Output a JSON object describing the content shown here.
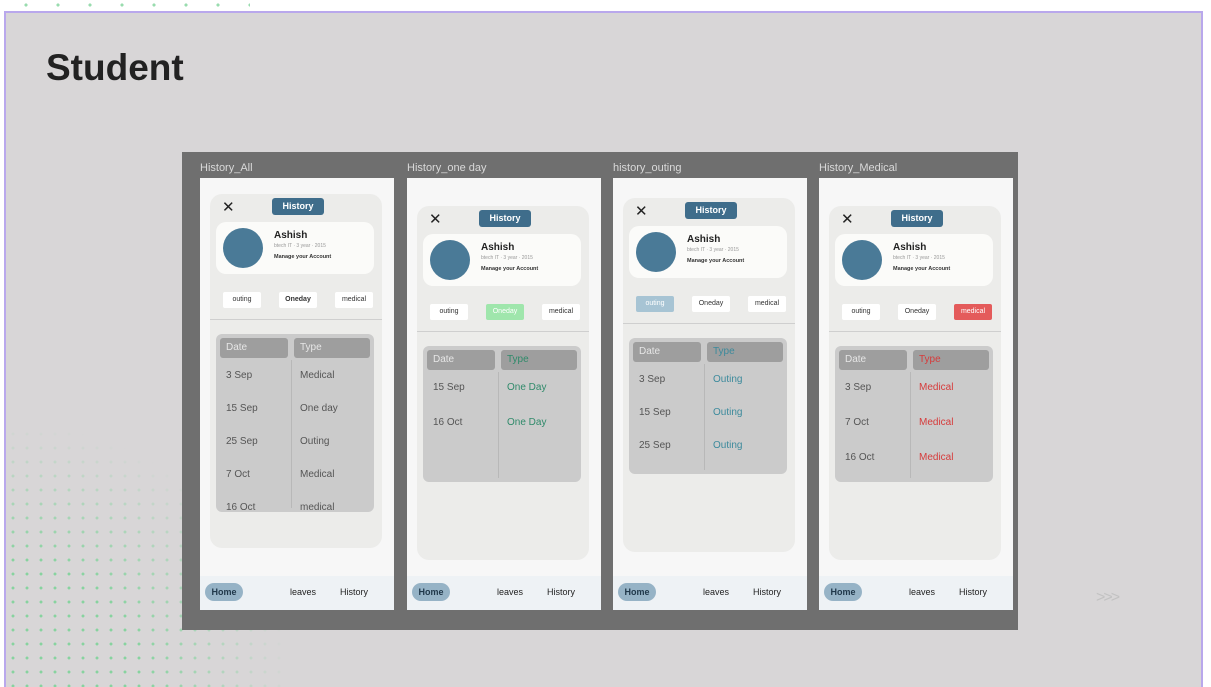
{
  "slide": {
    "title": "Student",
    "next_arrows": ">>>"
  },
  "screens": [
    {
      "label": "History_All",
      "header_button": "History",
      "close_glyph": "✕",
      "profile": {
        "name": "Ashish",
        "sub": "btech IT · 3 year · 2015",
        "manage": "Manage your Account"
      },
      "filters": [
        "outing",
        "Oneday",
        "medical"
      ],
      "active_filter": "",
      "columns": [
        "Date",
        "Type"
      ],
      "rows": [
        [
          "3 Sep",
          "Medical"
        ],
        [
          "15 Sep",
          "One day"
        ],
        [
          "25 Sep",
          "Outing"
        ],
        [
          "7 Oct",
          "Medical"
        ],
        [
          "16 Oct",
          "medical"
        ]
      ],
      "nav": [
        "Home",
        "leaves",
        "History"
      ]
    },
    {
      "label": "History_one day",
      "header_button": "History",
      "close_glyph": "✕",
      "profile": {
        "name": "Ashish",
        "sub": "btech IT · 3 year · 2015",
        "manage": "Manage your Account"
      },
      "filters": [
        "outing",
        "Oneday",
        "medical"
      ],
      "active_filter": "Oneday",
      "columns": [
        "Date",
        "Type"
      ],
      "rows": [
        [
          "15 Sep",
          "One Day"
        ],
        [
          "16 Oct",
          "One Day"
        ]
      ],
      "nav": [
        "Home",
        "leaves",
        "History"
      ]
    },
    {
      "label": "history_outing",
      "header_button": "History",
      "close_glyph": "✕",
      "profile": {
        "name": "Ashish",
        "sub": "btech IT · 3 year · 2015",
        "manage": "Manage your Account"
      },
      "filters": [
        "outing",
        "Oneday",
        "medical"
      ],
      "active_filter": "outing",
      "columns": [
        "Date",
        "Type"
      ],
      "rows": [
        [
          "3 Sep",
          "Outing"
        ],
        [
          "15 Sep",
          "Outing"
        ],
        [
          "25 Sep",
          "Outing"
        ]
      ],
      "nav": [
        "Home",
        "leaves",
        "History"
      ]
    },
    {
      "label": "History_Medical",
      "header_button": "History",
      "close_glyph": "✕",
      "profile": {
        "name": "Ashish",
        "sub": "btech IT · 3 year · 2015",
        "manage": "Manage your Account"
      },
      "filters": [
        "outing",
        "Oneday",
        "medical"
      ],
      "active_filter": "medical",
      "columns": [
        "Date",
        "Type"
      ],
      "rows": [
        [
          "3 Sep",
          "Medical"
        ],
        [
          "7 Oct",
          "Medical"
        ],
        [
          "16 Oct",
          "Medical"
        ]
      ],
      "nav": [
        "Home",
        "leaves",
        "History"
      ]
    }
  ],
  "colors": {
    "background": "#d8d6d7",
    "board": "#6f6f6f",
    "primary_button": "#3f6d8b",
    "avatar": "#4a7a97",
    "oneday_accent": "#2f8a6a",
    "oneday_active": "#9fe6ac",
    "outing_accent": "#3c8a9c",
    "outing_active": "#a7c4d4",
    "medical_accent": "#d63b3b",
    "medical_active": "#e45b5b",
    "dots": "#7fd39a"
  }
}
